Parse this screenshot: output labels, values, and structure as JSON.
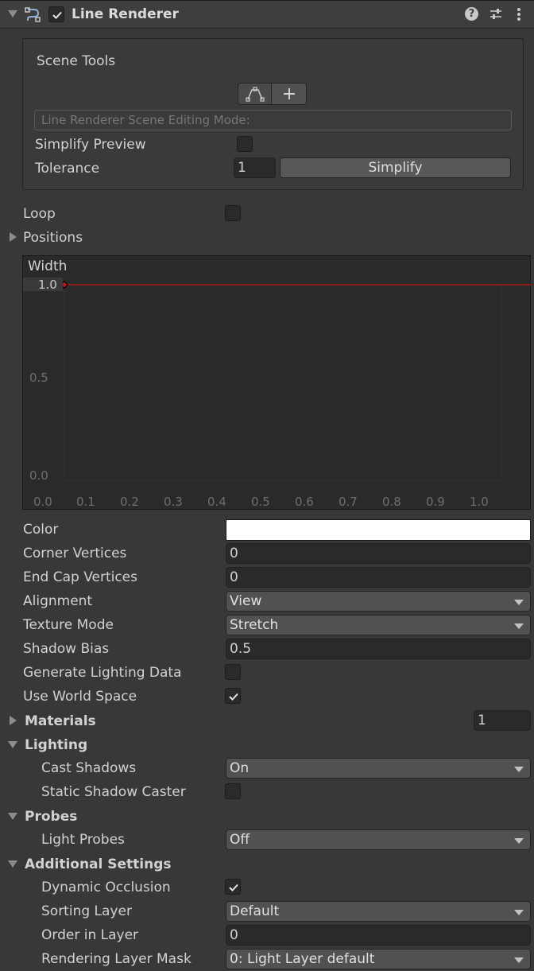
{
  "header": {
    "title": "Line Renderer",
    "enabled": true,
    "icons": [
      "line-renderer-component-icon",
      "help-icon",
      "preset-icon",
      "kebab-menu-icon"
    ]
  },
  "scene_tools": {
    "title": "Scene Tools",
    "edit_mode_label": "Line Renderer Scene Editing Mode:",
    "simplify_preview_label": "Simplify Preview",
    "simplify_preview_checked": false,
    "tolerance_label": "Tolerance",
    "tolerance_value": "1",
    "simplify_button": "Simplify"
  },
  "loop": {
    "label": "Loop",
    "checked": false
  },
  "positions": {
    "label": "Positions",
    "expanded": false
  },
  "width_curve": {
    "label": "Width",
    "y_ticks": [
      "1.0",
      "0.5",
      "0.0"
    ],
    "x_ticks": [
      "0.0",
      "0.1",
      "0.2",
      "0.3",
      "0.4",
      "0.5",
      "0.6",
      "0.7",
      "0.8",
      "0.9",
      "1.0"
    ],
    "curve_color": "#b0191b",
    "keyframes": [
      {
        "time": 0.0,
        "value": 1.0
      }
    ]
  },
  "props": {
    "color_label": "Color",
    "color_value": "#ffffff",
    "corner_vertices_label": "Corner Vertices",
    "corner_vertices_value": "0",
    "end_cap_vertices_label": "End Cap Vertices",
    "end_cap_vertices_value": "0",
    "alignment_label": "Alignment",
    "alignment_value": "View",
    "texture_mode_label": "Texture Mode",
    "texture_mode_value": "Stretch",
    "shadow_bias_label": "Shadow Bias",
    "shadow_bias_value": "0.5",
    "generate_lighting_label": "Generate Lighting Data",
    "generate_lighting_checked": false,
    "world_space_label": "Use World Space",
    "world_space_checked": true
  },
  "materials": {
    "label": "Materials",
    "count": "1",
    "expanded": false
  },
  "lighting": {
    "label": "Lighting",
    "cast_shadows_label": "Cast Shadows",
    "cast_shadows_value": "On",
    "static_shadow_label": "Static Shadow Caster",
    "static_shadow_checked": false
  },
  "probes": {
    "label": "Probes",
    "light_probes_label": "Light Probes",
    "light_probes_value": "Off"
  },
  "additional": {
    "label": "Additional Settings",
    "dynamic_occlusion_label": "Dynamic Occlusion",
    "dynamic_occlusion_checked": true,
    "sorting_layer_label": "Sorting Layer",
    "sorting_layer_value": "Default",
    "order_label": "Order in Layer",
    "order_value": "0",
    "rendering_mask_label": "Rendering Layer Mask",
    "rendering_mask_value": "0: Light Layer default"
  }
}
